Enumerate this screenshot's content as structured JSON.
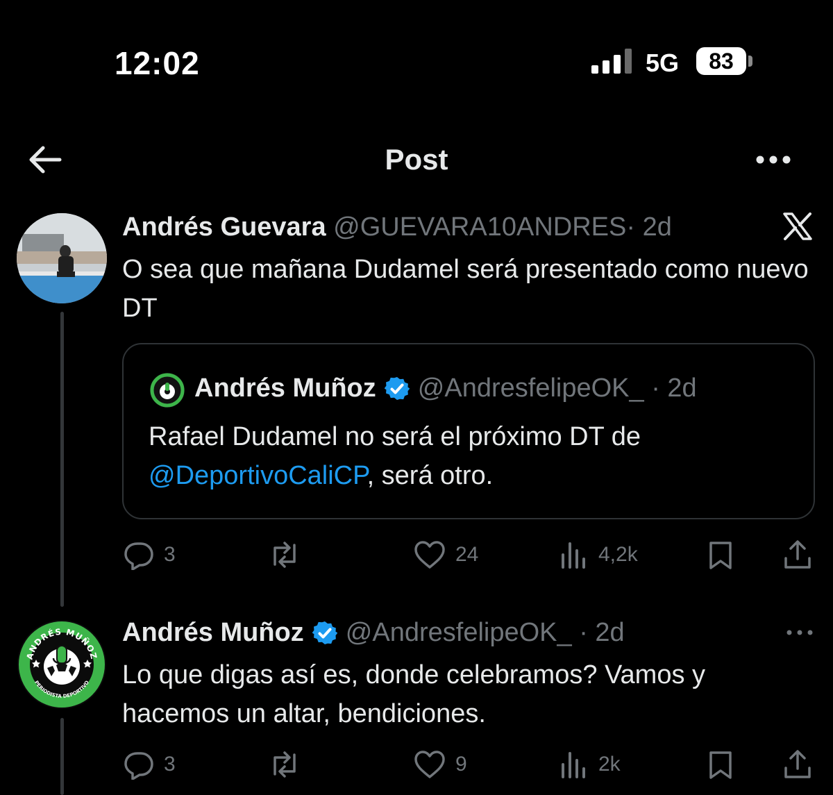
{
  "status_bar": {
    "time": "12:02",
    "network": "5G",
    "battery": "83"
  },
  "nav": {
    "title": "Post"
  },
  "posts": [
    {
      "author_name": "Andrés Guevara",
      "handle": "@GUEVARA10ANDRES",
      "time": "· 2d",
      "text": "O sea que mañana Dudamel será presentado como nuevo DT",
      "quote": {
        "author_name": "Andrés Muñoz",
        "handle": "@AndresfelipeOK_",
        "time": "· 2d",
        "text_before": "Rafael Dudamel no será el próximo DT de",
        "mention": "@DeportivoCaliCP",
        "text_after": ", será otro."
      },
      "stats": {
        "replies": "3",
        "likes": "24",
        "views": "4,2k"
      }
    },
    {
      "author_name": "Andrés Muñoz",
      "handle": "@AndresfelipeOK_",
      "time": "· 2d",
      "text": "Lo que digas así es, donde celebramos? Vamos y hacemos un altar, bendiciones.",
      "logo_text": {
        "top": "ANDRÉS MUÑOZ",
        "bottom": "PERIODISTA DEPORTIVO"
      },
      "stats": {
        "replies": "3",
        "likes": "9",
        "views": "2k"
      }
    }
  ],
  "colors": {
    "background": "#000000",
    "text": "#e7e9ea",
    "muted": "#71767b",
    "link": "#1d9bf0",
    "verified": "#1d9bf0",
    "border": "#2f3336",
    "logo_green": "#3db54a"
  }
}
